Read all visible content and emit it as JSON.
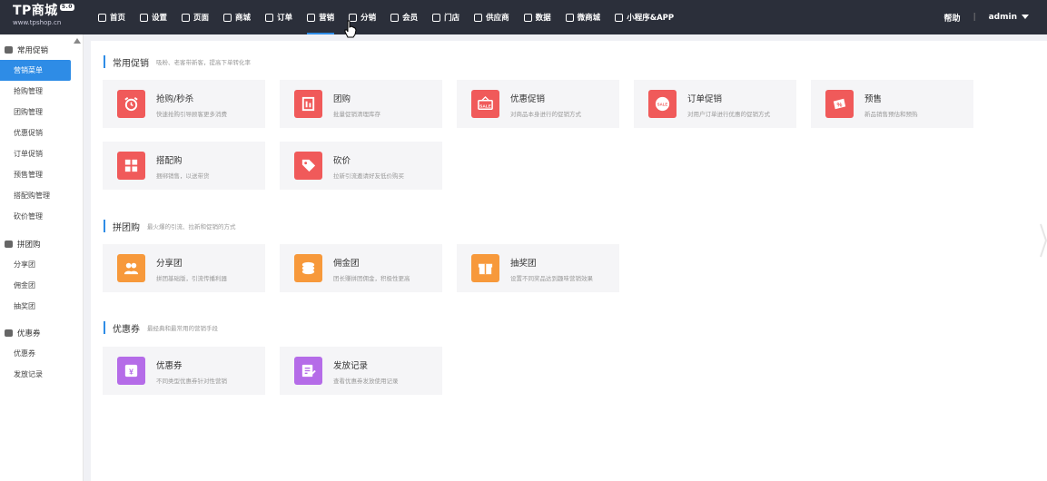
{
  "brand": {
    "name": "TP商城",
    "badge": "5.0",
    "url": "www.tpshop.cn"
  },
  "nav": [
    {
      "label": "首页"
    },
    {
      "label": "设置"
    },
    {
      "label": "页面"
    },
    {
      "label": "商城"
    },
    {
      "label": "订单"
    },
    {
      "label": "营销",
      "active": true
    },
    {
      "label": "分销"
    },
    {
      "label": "会员"
    },
    {
      "label": "门店"
    },
    {
      "label": "供应商"
    },
    {
      "label": "数据"
    },
    {
      "label": "微商城"
    },
    {
      "label": "小程序&APP"
    }
  ],
  "header_right": {
    "help": "帮助",
    "sep": "|",
    "user": "admin"
  },
  "sidebar": {
    "groups": [
      {
        "label": "常用促销",
        "items": [
          "营销菜单",
          "抢购管理",
          "团购管理",
          "优惠促销",
          "订单促销",
          "预售管理",
          "搭配购管理",
          "砍价管理"
        ]
      },
      {
        "label": "拼团购",
        "items": [
          "分享团",
          "佣金团",
          "抽奖团"
        ]
      },
      {
        "label": "优惠券",
        "items": [
          "优惠券",
          "发放记录"
        ]
      }
    ]
  },
  "sections": [
    {
      "title": "常用促销",
      "desc": "吸粉、老客带新客，提高下单转化率",
      "cards": [
        {
          "title": "抢购/秒杀",
          "desc": "快速抢购引导顾客更多消费",
          "icon": "alarm-clock-icon",
          "color": "red"
        },
        {
          "title": "团购",
          "desc": "批量促销清理库存",
          "icon": "building-icon",
          "color": "red"
        },
        {
          "title": "优惠促销",
          "desc": "对商品本身进行的促销方式",
          "icon": "sale-tag-icon",
          "color": "red"
        },
        {
          "title": "订单促销",
          "desc": "对用户订单进行优惠的促销方式",
          "icon": "sale-badge-icon",
          "color": "red"
        },
        {
          "title": "预售",
          "desc": "新品销售预估和预热",
          "icon": "percent-tag-icon",
          "color": "red"
        },
        {
          "title": "搭配购",
          "desc": "捆绑销售，以送带货",
          "icon": "puzzle-icon",
          "color": "red"
        },
        {
          "title": "砍价",
          "desc": "拉新引流邀请好友低价购买",
          "icon": "price-tag-icon",
          "color": "red"
        }
      ]
    },
    {
      "title": "拼团购",
      "desc": "最火爆的引流、拉新和促销的方式",
      "cards": [
        {
          "title": "分享团",
          "desc": "拼团基础版，引流传播利器",
          "icon": "people-icon",
          "color": "orange"
        },
        {
          "title": "佣金团",
          "desc": "团长赚拼团佣金，积极性更高",
          "icon": "coins-icon",
          "color": "orange"
        },
        {
          "title": "抽奖团",
          "desc": "设置不同奖品达到趣味营销效果",
          "icon": "gift-icon",
          "color": "orange"
        }
      ]
    },
    {
      "title": "优惠券",
      "desc": "最经典和最常用的营销手段",
      "cards": [
        {
          "title": "优惠券",
          "desc": "不同类型优惠券针对性营销",
          "icon": "yen-ticket-icon",
          "color": "purple"
        },
        {
          "title": "发放记录",
          "desc": "查看优惠券发放使用记录",
          "icon": "edit-note-icon",
          "color": "purple"
        }
      ]
    }
  ]
}
